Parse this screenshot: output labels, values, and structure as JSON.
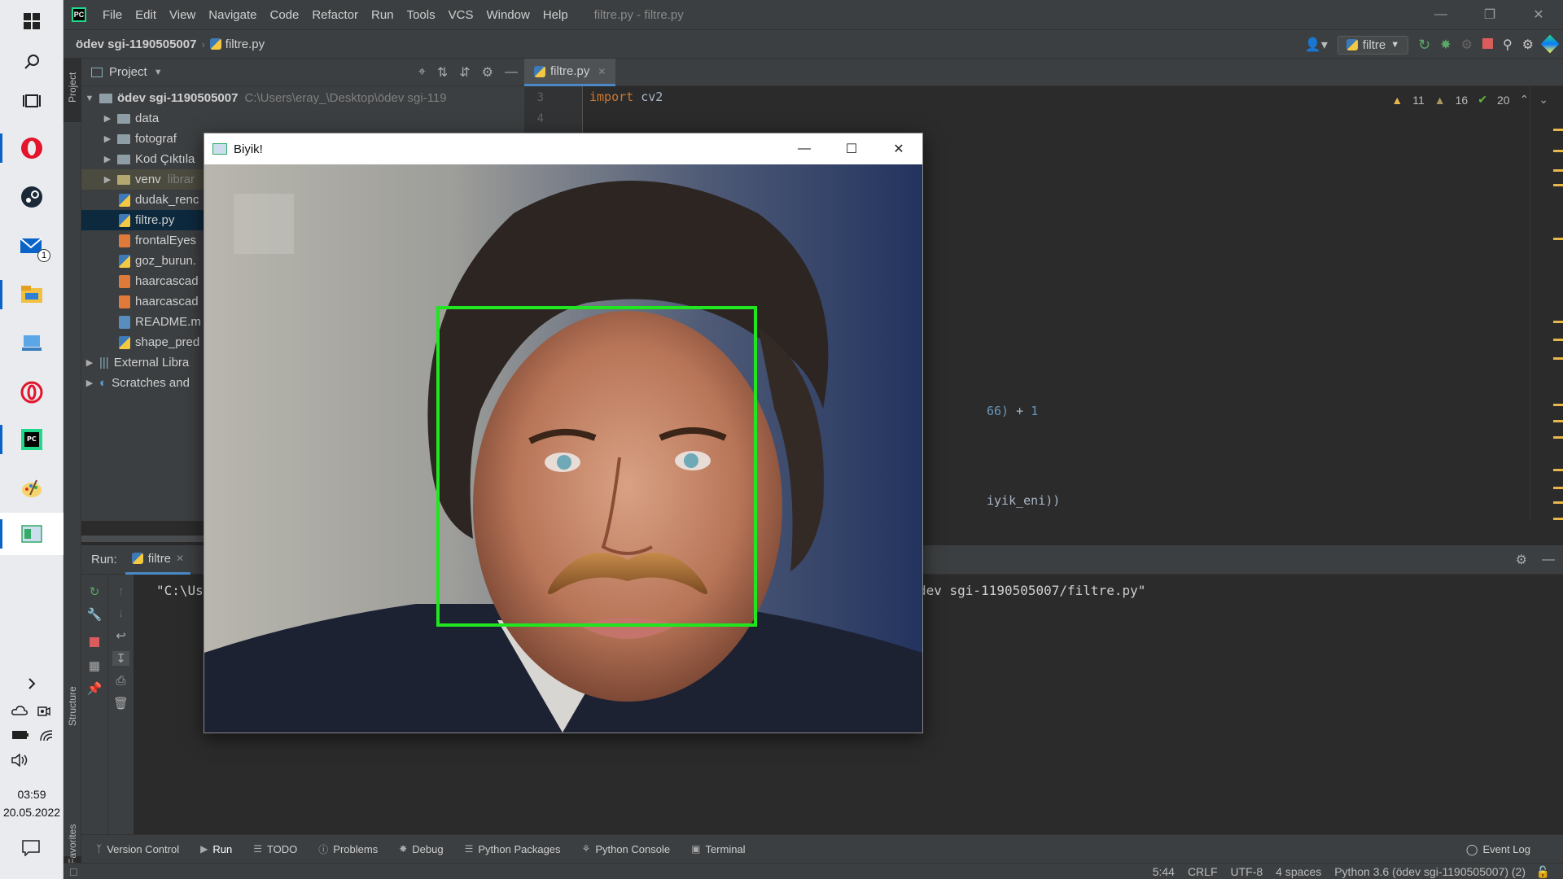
{
  "taskbar": {
    "mail_badge": "1",
    "time": "03:59",
    "date": "20.05.2022"
  },
  "menu": [
    "File",
    "Edit",
    "View",
    "Navigate",
    "Code",
    "Refactor",
    "Run",
    "Tools",
    "VCS",
    "Window",
    "Help"
  ],
  "window_title": "filtre.py - filtre.py",
  "navbar": {
    "project": "ödev sgi-1190505007",
    "file": "filtre.py",
    "run_config": "filtre"
  },
  "side_stripe": {
    "project": "Project",
    "structure": "Structure",
    "favorites": "Favorites"
  },
  "project_panel": {
    "title": "Project",
    "root_name": "ödev sgi-1190505007",
    "root_path": "C:\\Users\\eray_\\Desktop\\ödev sgi-119",
    "items": [
      {
        "label": "data",
        "type": "folder"
      },
      {
        "label": "fotograf",
        "type": "folder"
      },
      {
        "label": "Kod Çıktıla",
        "type": "folder"
      },
      {
        "label": "venv",
        "type": "folder",
        "note": "librar"
      },
      {
        "label": "dudak_renc",
        "type": "py"
      },
      {
        "label": "filtre.py",
        "type": "py"
      },
      {
        "label": "frontalEyes",
        "type": "xml"
      },
      {
        "label": "goz_burun.",
        "type": "py"
      },
      {
        "label": "haarcascad",
        "type": "xml"
      },
      {
        "label": "haarcascad",
        "type": "xml"
      },
      {
        "label": "README.m",
        "type": "md"
      },
      {
        "label": "shape_pred",
        "type": "py"
      }
    ],
    "external": "External Libra",
    "scratches": "Scratches and"
  },
  "editor": {
    "tab": "filtre.py",
    "line3": "3",
    "line4": "4",
    "import_kw": "import",
    "import_mod": "cv2",
    "frag1_a": "66)",
    "frag1_b": " + ",
    "frag1_c": "1",
    "frag2": "iyik_eni))",
    "warnings": "11",
    "weak_warnings": "16",
    "ok_count": "20"
  },
  "run_panel": {
    "label": "Run:",
    "tab": "filtre",
    "console_start": "\"C:\\Us",
    "console_end": "dev sgi-1190505007/filtre.py\""
  },
  "toolwindows": [
    "Version Control",
    "Run",
    "TODO",
    "Problems",
    "Debug",
    "Python Packages",
    "Python Console",
    "Terminal"
  ],
  "event_log": "Event Log",
  "status": {
    "position": "5:44",
    "line_sep": "CRLF",
    "encoding": "UTF-8",
    "indent": "4 spaces",
    "interpreter": "Python 3.6 (ödev sgi-1190505007) (2)"
  },
  "cv_window": {
    "title": "Biyik!"
  }
}
